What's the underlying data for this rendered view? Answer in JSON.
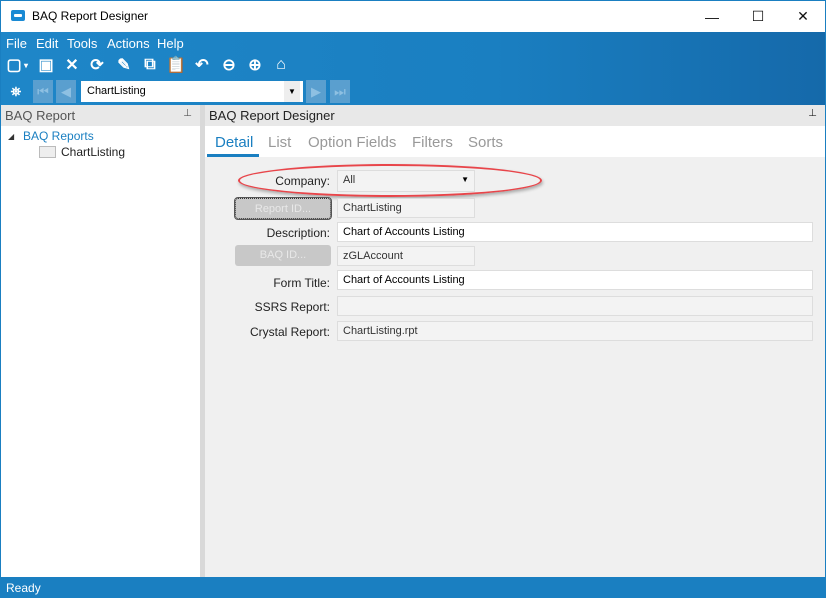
{
  "window": {
    "title": "BAQ Report Designer",
    "minimize": "—",
    "maximize": "☐",
    "close": "✕"
  },
  "menu": [
    "File",
    "Edit",
    "Tools",
    "Actions",
    "Help"
  ],
  "toolbar": {
    "icons": [
      "new-icon",
      "save-icon",
      "delete-icon",
      "refresh-icon",
      "clear-icon",
      "copy-icon",
      "paste-icon",
      "undo-icon",
      "back-icon",
      "forward-icon",
      "home-icon"
    ]
  },
  "nav": {
    "current": "ChartListing"
  },
  "left_panel": {
    "title": "BAQ Report",
    "tree": {
      "root": "BAQ Reports",
      "children": [
        "ChartListing"
      ]
    }
  },
  "right_panel": {
    "title": "BAQ Report Designer",
    "tabs": [
      "Detail",
      "List",
      "Option Fields",
      "Filters",
      "Sorts"
    ],
    "form": {
      "company_label": "Company:",
      "company_value": "All",
      "report_id_button": "Report ID...",
      "report_id_value": "ChartListing",
      "description_label": "Description:",
      "description_value": "Chart of Accounts Listing",
      "baq_id_button": "BAQ ID...",
      "baq_id_value": "zGLAccount",
      "form_title_label": "Form Title:",
      "form_title_value": "Chart of Accounts Listing",
      "ssrs_label": "SSRS Report:",
      "ssrs_value": "",
      "crystal_label": "Crystal Report:",
      "crystal_value": "ChartListing.rpt"
    }
  },
  "status": "Ready"
}
